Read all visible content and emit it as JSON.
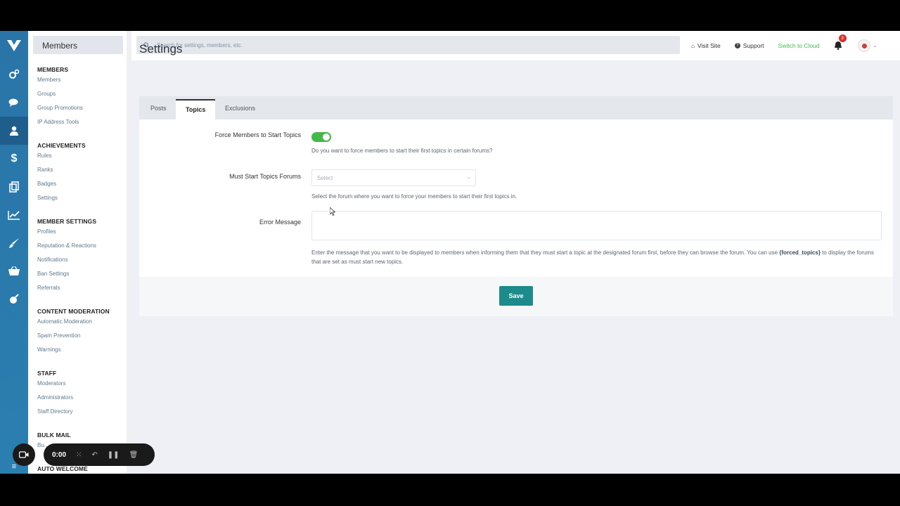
{
  "area_title": "Members",
  "nav": [
    {
      "title": "MEMBERS",
      "items": [
        "Members",
        "Groups",
        "Group Promotions",
        "IP Address Tools"
      ]
    },
    {
      "title": "ACHIEVEMENTS",
      "items": [
        "Rules",
        "Ranks",
        "Badges",
        "Settings"
      ]
    },
    {
      "title": "MEMBER SETTINGS",
      "items": [
        "Profiles",
        "Reputation & Reactions",
        "Notifications",
        "Ban Settings",
        "Referrals"
      ]
    },
    {
      "title": "CONTENT MODERATION",
      "items": [
        "Automatic Moderation",
        "Spam Prevention",
        "Warnings"
      ]
    },
    {
      "title": "STAFF",
      "items": [
        "Moderators",
        "Administrators",
        "Staff Directory"
      ]
    },
    {
      "title": "BULK MAIL",
      "items": [
        "Bu..."
      ]
    },
    {
      "title": "AUTO WELCOME",
      "items": []
    }
  ],
  "rail_icons": [
    "cogs-icon",
    "comments-icon",
    "user-icon",
    "dollar-icon",
    "files-icon",
    "chart-icon",
    "brush-icon",
    "shop-icon",
    "rocket-icon"
  ],
  "search": {
    "placeholder": "Search for settings, members, etc."
  },
  "top": {
    "visit_site": "Visit Site",
    "support": "Support",
    "switch_cloud": "Switch to Cloud",
    "notif_count": "3"
  },
  "page_title": "Settings",
  "tabs": [
    "Posts",
    "Topics",
    "Exclusions"
  ],
  "active_tab": "Topics",
  "form": {
    "force_label": "Force Members to Start Topics",
    "force_on": true,
    "force_desc": "Do you want to force members to start their first topics in certain forums?",
    "forums_label": "Must Start Topics Forums",
    "forums_placeholder": "Select",
    "forums_desc": "Select the forum where you want to force your members to start their first topics in.",
    "error_label": "Error Message",
    "error_value": "",
    "error_desc_1": "Enter the message that you want to be displayed to members when informing them that they must start a topic at the designated forum first, before they can browse the forum. You can use ",
    "error_desc_code": "{forced_topics}",
    "error_desc_2": " to display the forums that are set as must start new topics."
  },
  "save_label": "Save",
  "recorder": {
    "time": "0:00"
  },
  "colors": {
    "rail": "#2b7ab0",
    "toggle_on": "#44b848",
    "save": "#1d8b8c",
    "cloud": "#3fbd4f",
    "badge": "#d93030"
  }
}
